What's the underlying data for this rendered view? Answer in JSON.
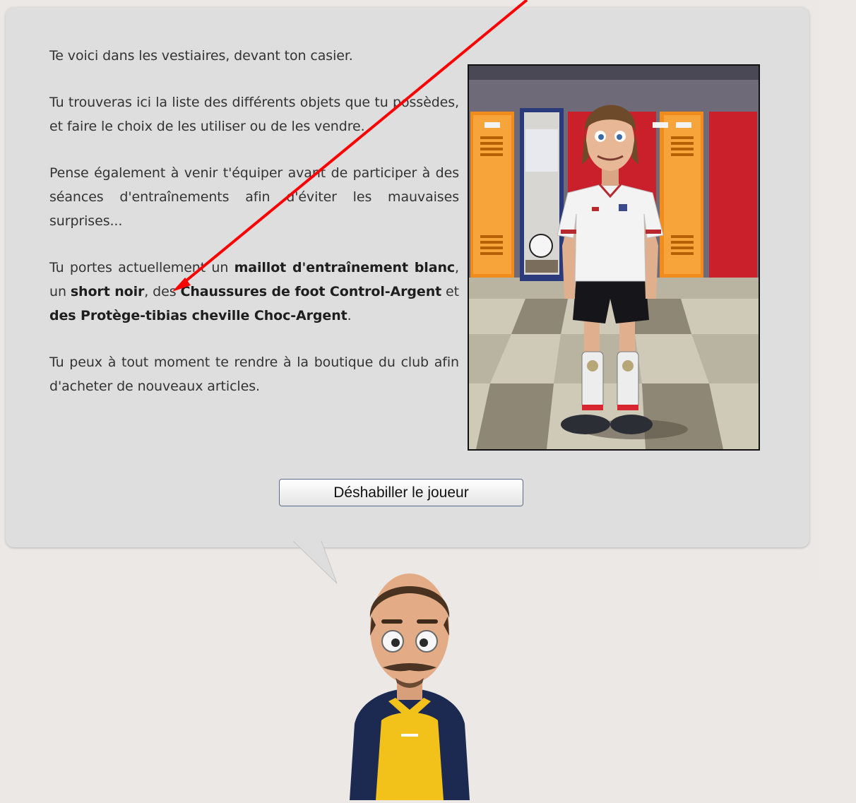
{
  "locker_room": {
    "paragraph_1": "Te voici dans les vestiaires, devant ton casier.",
    "paragraph_2": "Tu trouveras ici la liste des différents objets que tu possèdes, et faire le choix de les utiliser ou de les vendre.",
    "paragraph_3": "Pense également à venir t'équiper avant de participer à des séances d'entraînements afin d'éviter les mauvaises surprises...",
    "paragraph_4": {
      "t1": "Tu portes actuellement un ",
      "b1": "maillot d'entraînement blanc",
      "t2": ", un ",
      "b2": "short noir",
      "t3": ", des ",
      "b3": "Chaussures de foot Control-Argent",
      "t4": " et ",
      "b4": "des Protège-tibias cheville Choc-Argent",
      "t5": "."
    },
    "paragraph_5": "Tu peux à tout moment te rendre à la boutique du club afin d'acheter de nouveaux articles.",
    "undress_button_label": "Déshabiller le joueur"
  },
  "icons": {
    "player_illustration": "player-in-locker-room",
    "coach_avatar": "coach-avatar",
    "annotation": "red-arrow-annotation"
  },
  "colors": {
    "page_background": "#ebe8e6",
    "bubble_background": "#dedede",
    "annotation_arrow": "#ff0000",
    "coach_shirt_primary": "#1c2a52",
    "coach_shirt_accent": "#f2c21a"
  }
}
